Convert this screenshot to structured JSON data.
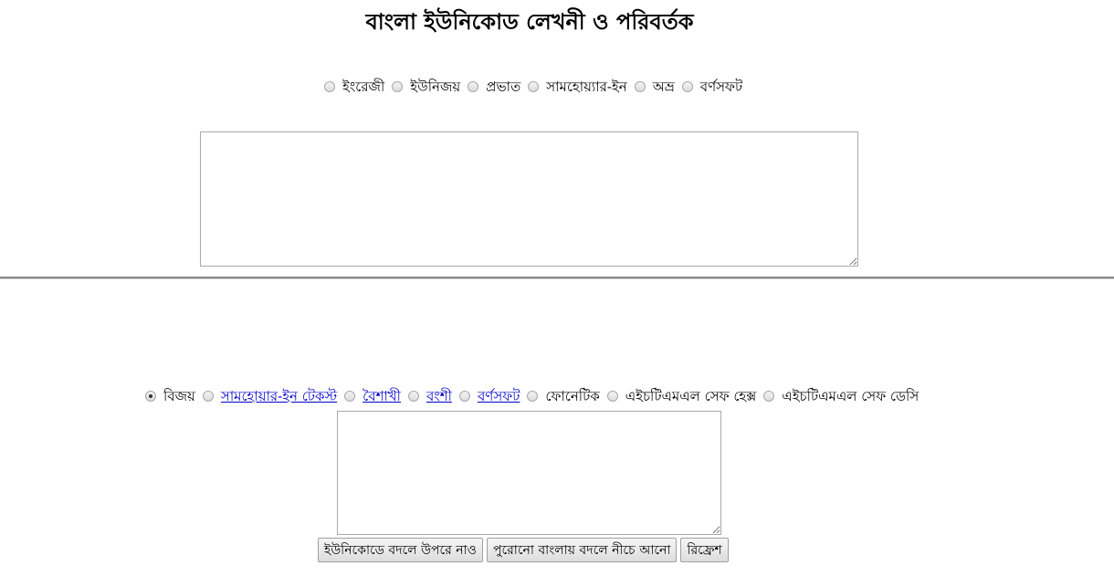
{
  "header": {
    "title": "বাংলা ইউনিকোড লেখনী ও পরিবর্তক"
  },
  "input_layouts": [
    {
      "label": "ইংরেজী",
      "checked": false
    },
    {
      "label": "ইউনিজয়",
      "checked": false
    },
    {
      "label": "প্রভাত",
      "checked": false
    },
    {
      "label": "সামহোয়্যার-ইন",
      "checked": false
    },
    {
      "label": "অভ্র",
      "checked": false
    },
    {
      "label": "বর্ণসফট",
      "checked": false
    }
  ],
  "converter_formats": [
    {
      "label": "বিজয়",
      "checked": true,
      "link": false
    },
    {
      "label": "সামহোয়ার-ইন টেকস্ট",
      "checked": false,
      "link": true
    },
    {
      "label": "বৈশাখী",
      "checked": false,
      "link": true
    },
    {
      "label": "বংশী",
      "checked": false,
      "link": true
    },
    {
      "label": "বর্ণসফট",
      "checked": false,
      "link": true
    },
    {
      "label": "ফোনেটিক",
      "checked": false,
      "link": false
    },
    {
      "label": "এইচটিএমএল সেফ হেক্স",
      "checked": false,
      "link": false
    },
    {
      "label": "এইচটিএমএল সেফ ডেসি",
      "checked": false,
      "link": false
    }
  ],
  "editor": {
    "value": "",
    "placeholder": ""
  },
  "converter": {
    "value": "",
    "placeholder": ""
  },
  "actions": {
    "to_unicode_label": "ইউনিকোডে বদলে উপরে নাও",
    "to_legacy_label": "পুরোনো বাংলায় বদলে নীচে আনো",
    "refresh_label": "রিফ্রেশ"
  }
}
